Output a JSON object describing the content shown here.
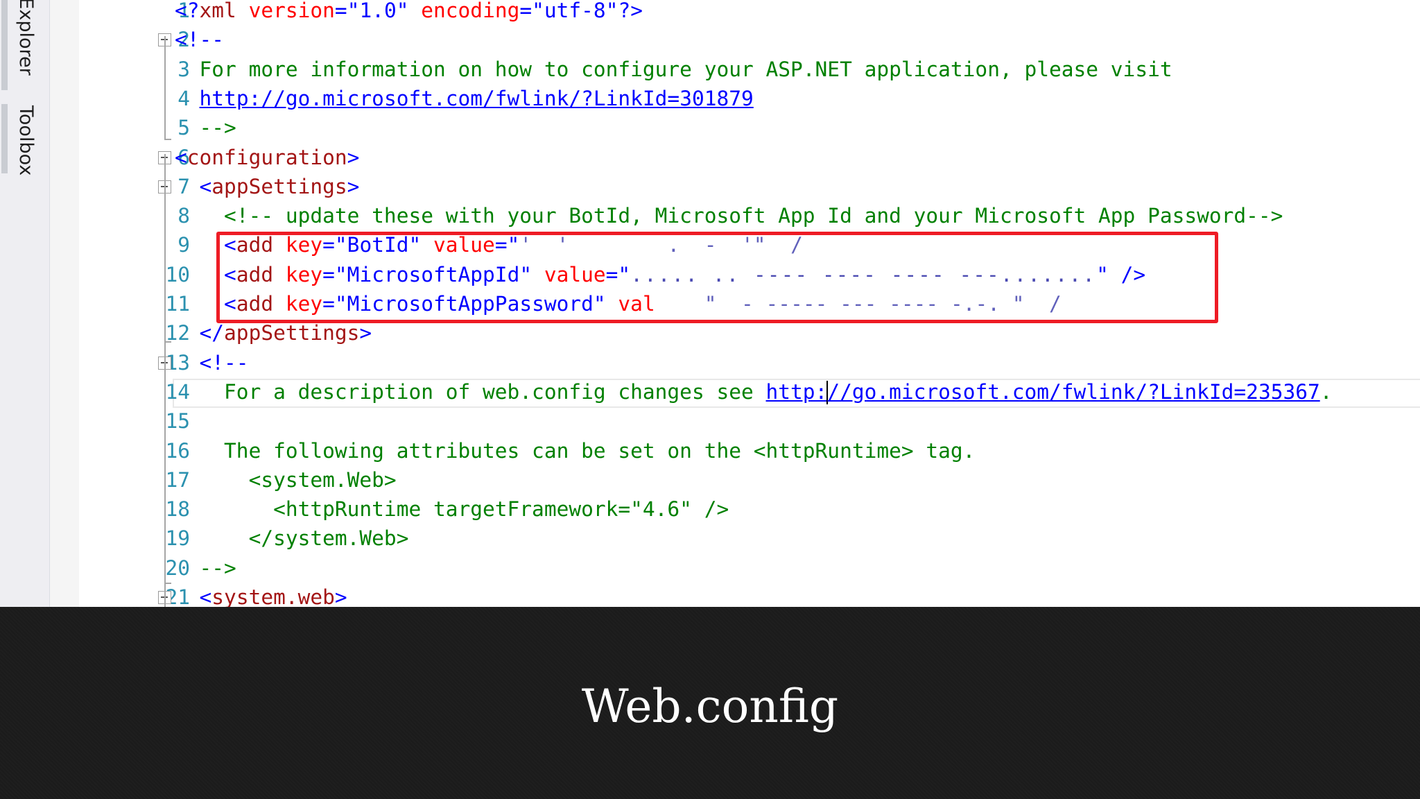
{
  "sidebar": {
    "tabs": [
      {
        "label": "er Explorer"
      },
      {
        "label": "Toolbox"
      }
    ]
  },
  "editor": {
    "lines": [
      {
        "num": "1",
        "tokens": [
          [
            "b",
            "<?"
          ],
          [
            "m",
            "xml"
          ],
          [
            "r",
            " version"
          ],
          [
            "b",
            "="
          ],
          [
            "b",
            "\"1.0\""
          ],
          [
            "r",
            " encoding"
          ],
          [
            "b",
            "="
          ],
          [
            "b",
            "\"utf-8\""
          ],
          [
            "b",
            "?>"
          ]
        ]
      },
      {
        "num": "2",
        "tokens": [
          [
            "b",
            "<!--"
          ]
        ]
      },
      {
        "num": "3",
        "tokens": [
          [
            "g",
            "  For more information on how to configure your ASP.NET application, please visit"
          ]
        ]
      },
      {
        "num": "4",
        "tokens": [
          [
            "g",
            "  "
          ],
          [
            "lnk",
            "http://go.microsoft.com/fwlink/?LinkId=301879"
          ]
        ]
      },
      {
        "num": "5",
        "tokens": [
          [
            "g",
            "  -->"
          ]
        ]
      },
      {
        "num": "6",
        "tokens": [
          [
            "b",
            "<"
          ],
          [
            "m",
            "configuration"
          ],
          [
            "b",
            ">"
          ]
        ]
      },
      {
        "num": "7",
        "tokens": [
          [
            "b",
            "  <"
          ],
          [
            "m",
            "appSettings"
          ],
          [
            "b",
            ">"
          ]
        ]
      },
      {
        "num": "8",
        "tokens": [
          [
            "g",
            "    <!-- update these with your BotId, Microsoft App Id and your Microsoft App Password-->"
          ]
        ]
      },
      {
        "num": "9",
        "tokens": [
          [
            "b",
            "    <"
          ],
          [
            "m",
            "add"
          ],
          [
            "r",
            " key"
          ],
          [
            "b",
            "="
          ],
          [
            "b",
            "\"BotId\""
          ],
          [
            "r",
            " value"
          ],
          [
            "b",
            "=\""
          ],
          [
            "redact-l",
            "'  '        .  -  '\"  /"
          ]
        ]
      },
      {
        "num": "10",
        "tokens": [
          [
            "b",
            "    <"
          ],
          [
            "m",
            "add"
          ],
          [
            "r",
            " key"
          ],
          [
            "b",
            "="
          ],
          [
            "b",
            "\"MicrosoftAppId\""
          ],
          [
            "r",
            " value"
          ],
          [
            "b",
            "=\""
          ],
          [
            "redact",
            "..... .. ---- ---- ---- ---......."
          ],
          [
            "b",
            "\" />"
          ]
        ]
      },
      {
        "num": "11",
        "tokens": [
          [
            "b",
            "    <"
          ],
          [
            "m",
            "add"
          ],
          [
            "r",
            " key"
          ],
          [
            "b",
            "="
          ],
          [
            "b",
            "\"MicrosoftAppPassword\""
          ],
          [
            "r",
            " val"
          ],
          [
            "redact-l",
            "    \"  - ----- --- ---- -.-. \"  /"
          ]
        ]
      },
      {
        "num": "12",
        "tokens": [
          [
            "b",
            "  </"
          ],
          [
            "m",
            "appSettings"
          ],
          [
            "b",
            ">"
          ]
        ]
      },
      {
        "num": "13",
        "tokens": [
          [
            "b",
            "  <!--"
          ]
        ]
      },
      {
        "num": "14",
        "tokens": [
          [
            "g",
            "    For a description of web.config changes see "
          ],
          [
            "lnk",
            "http:"
          ],
          [
            "caret",
            ""
          ],
          [
            "lnk",
            "//go.microsoft.com/fwlink/?LinkId=235367"
          ],
          [
            "g",
            "."
          ]
        ]
      },
      {
        "num": "15",
        "tokens": [
          [
            "g",
            " "
          ]
        ]
      },
      {
        "num": "16",
        "tokens": [
          [
            "g",
            "    The following attributes can be set on the <httpRuntime> tag."
          ]
        ]
      },
      {
        "num": "17",
        "tokens": [
          [
            "g",
            "      <system.Web>"
          ]
        ]
      },
      {
        "num": "18",
        "tokens": [
          [
            "g",
            "        <httpRuntime targetFramework=\"4.6\" />"
          ]
        ]
      },
      {
        "num": "19",
        "tokens": [
          [
            "g",
            "      </system.Web>"
          ]
        ]
      },
      {
        "num": "20",
        "tokens": [
          [
            "g",
            "  -->"
          ]
        ]
      },
      {
        "num": "21",
        "tokens": [
          [
            "b",
            "  <"
          ],
          [
            "m",
            "system.web"
          ],
          [
            "b",
            ">"
          ]
        ]
      }
    ]
  },
  "colors": {
    "highlight_box": "#ee1c25",
    "line_number": "#2b91af",
    "xml_delimiter": "#0000ff",
    "xml_name": "#a31515",
    "xml_attribute": "#ff0000",
    "comment": "#008000"
  },
  "caption": {
    "title": "Web.config"
  }
}
